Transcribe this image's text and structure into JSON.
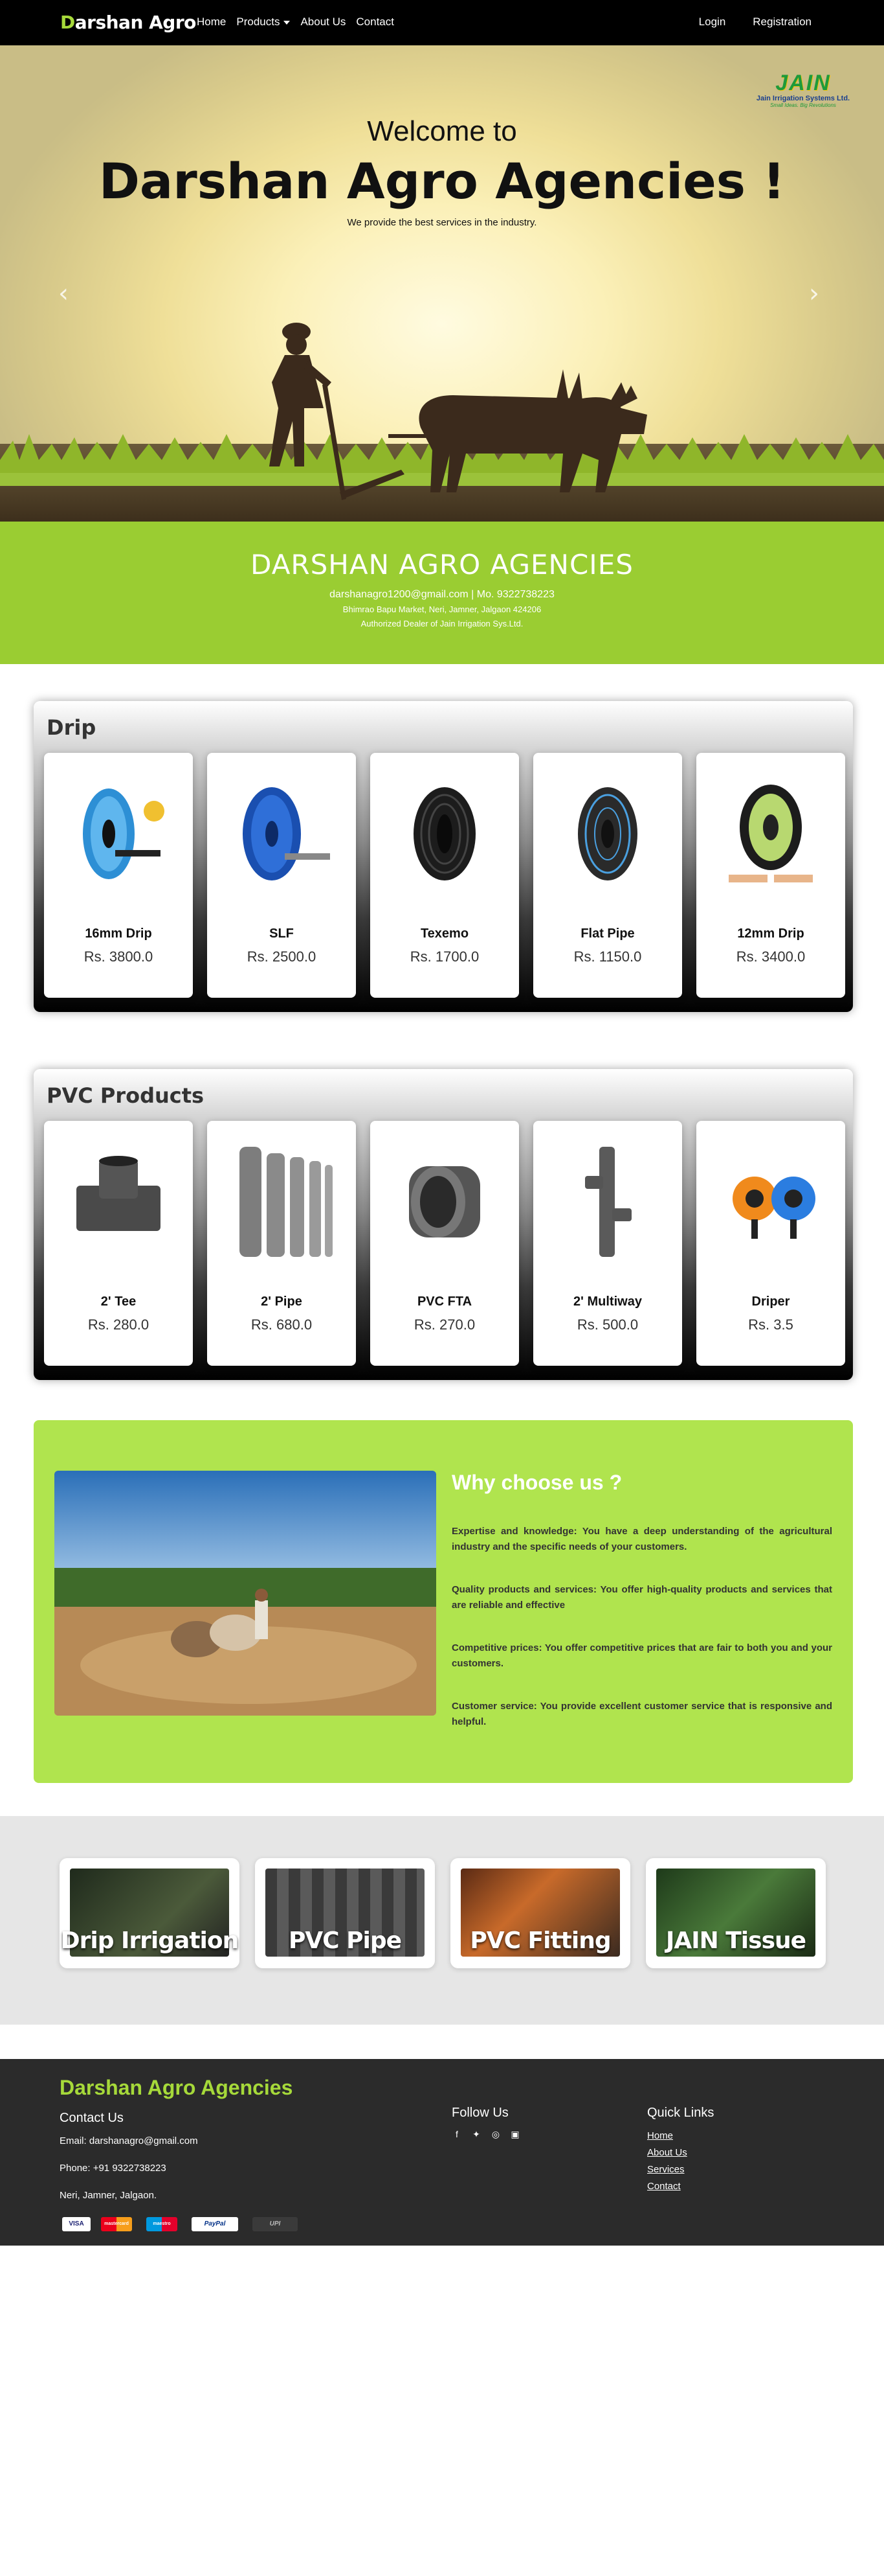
{
  "nav": {
    "brand_first": "D",
    "brand_rest": "arshan Agro",
    "links": [
      "Home",
      "Products",
      "About Us",
      "Contact"
    ],
    "login": "Login",
    "register": "Registration"
  },
  "hero": {
    "welcome": "Welcome to",
    "title": "Darshan Agro Agencies !",
    "subtitle": "We provide the best services in the industry.",
    "logo_word": "JAIN",
    "logo_company": "Jain Irrigation Systems Ltd.",
    "logo_tagline": "Small Ideas. Big Revolutions",
    "prev_icon": "chevron-left-icon",
    "next_icon": "chevron-right-icon"
  },
  "band": {
    "title": "DARSHAN AGRO AGENCIES",
    "contact": "darshanagro1200@gmail.com | Mo. 9322738223",
    "address": "Bhimrao Bapu Market, Neri, Jamner, Jalgaon 424206",
    "dealer": "Authorized Dealer of Jain Irrigation Sys.Ltd."
  },
  "drip": {
    "title": "Drip",
    "products": [
      {
        "name": "16mm Drip",
        "price": "Rs. 3800.0"
      },
      {
        "name": "SLF",
        "price": "Rs. 2500.0"
      },
      {
        "name": "Texemo",
        "price": "Rs. 1700.0"
      },
      {
        "name": "Flat Pipe",
        "price": "Rs. 1150.0"
      },
      {
        "name": "12mm Drip",
        "price": "Rs. 3400.0"
      }
    ]
  },
  "pvc": {
    "title": "PVC Products",
    "products": [
      {
        "name": "2' Tee",
        "price": "Rs. 280.0"
      },
      {
        "name": "2' Pipe",
        "price": "Rs. 680.0"
      },
      {
        "name": "PVC FTA",
        "price": "Rs. 270.0"
      },
      {
        "name": "2' Multiway",
        "price": "Rs. 500.0"
      },
      {
        "name": "Driper",
        "price": "Rs. 3.5"
      }
    ]
  },
  "why": {
    "title": "Why choose us ?",
    "points": [
      "Expertise and knowledge: You have a deep understanding of the agricultural industry and the specific needs of your customers.",
      "Quality products and services: You offer high-quality products and services that are reliable and effective",
      "Competitive prices: You offer competitive prices that are fair to both you and your customers.",
      "Customer service: You provide excellent customer service that is responsive and helpful."
    ]
  },
  "categories": [
    "Drip Irrigation",
    "PVC Pipe",
    "PVC Fitting",
    "JAIN Tissue"
  ],
  "footer": {
    "brand": "Darshan Agro Agencies",
    "contact_heading": "Contact Us",
    "email": "Email: darshanagro@gmail.com",
    "phone": "Phone: +91 9322738223",
    "address": "Neri, Jamner, Jalgaon.",
    "follow_heading": "Follow Us",
    "social_icons": [
      "facebook-icon",
      "twitter-icon",
      "instagram-icon",
      "linkedin-icon"
    ],
    "quick_heading": "Quick Links",
    "quick_links": [
      "Home",
      "About Us",
      "Services",
      "Contact"
    ],
    "payments": [
      "VISA",
      "mastercard",
      "maestro",
      "PayPal",
      "UPI"
    ]
  },
  "colors": {
    "accent_green": "#9acd32",
    "brand_green": "#a6d93a",
    "why_green": "#b0e44e",
    "footer_bg": "#2b2b2b"
  }
}
